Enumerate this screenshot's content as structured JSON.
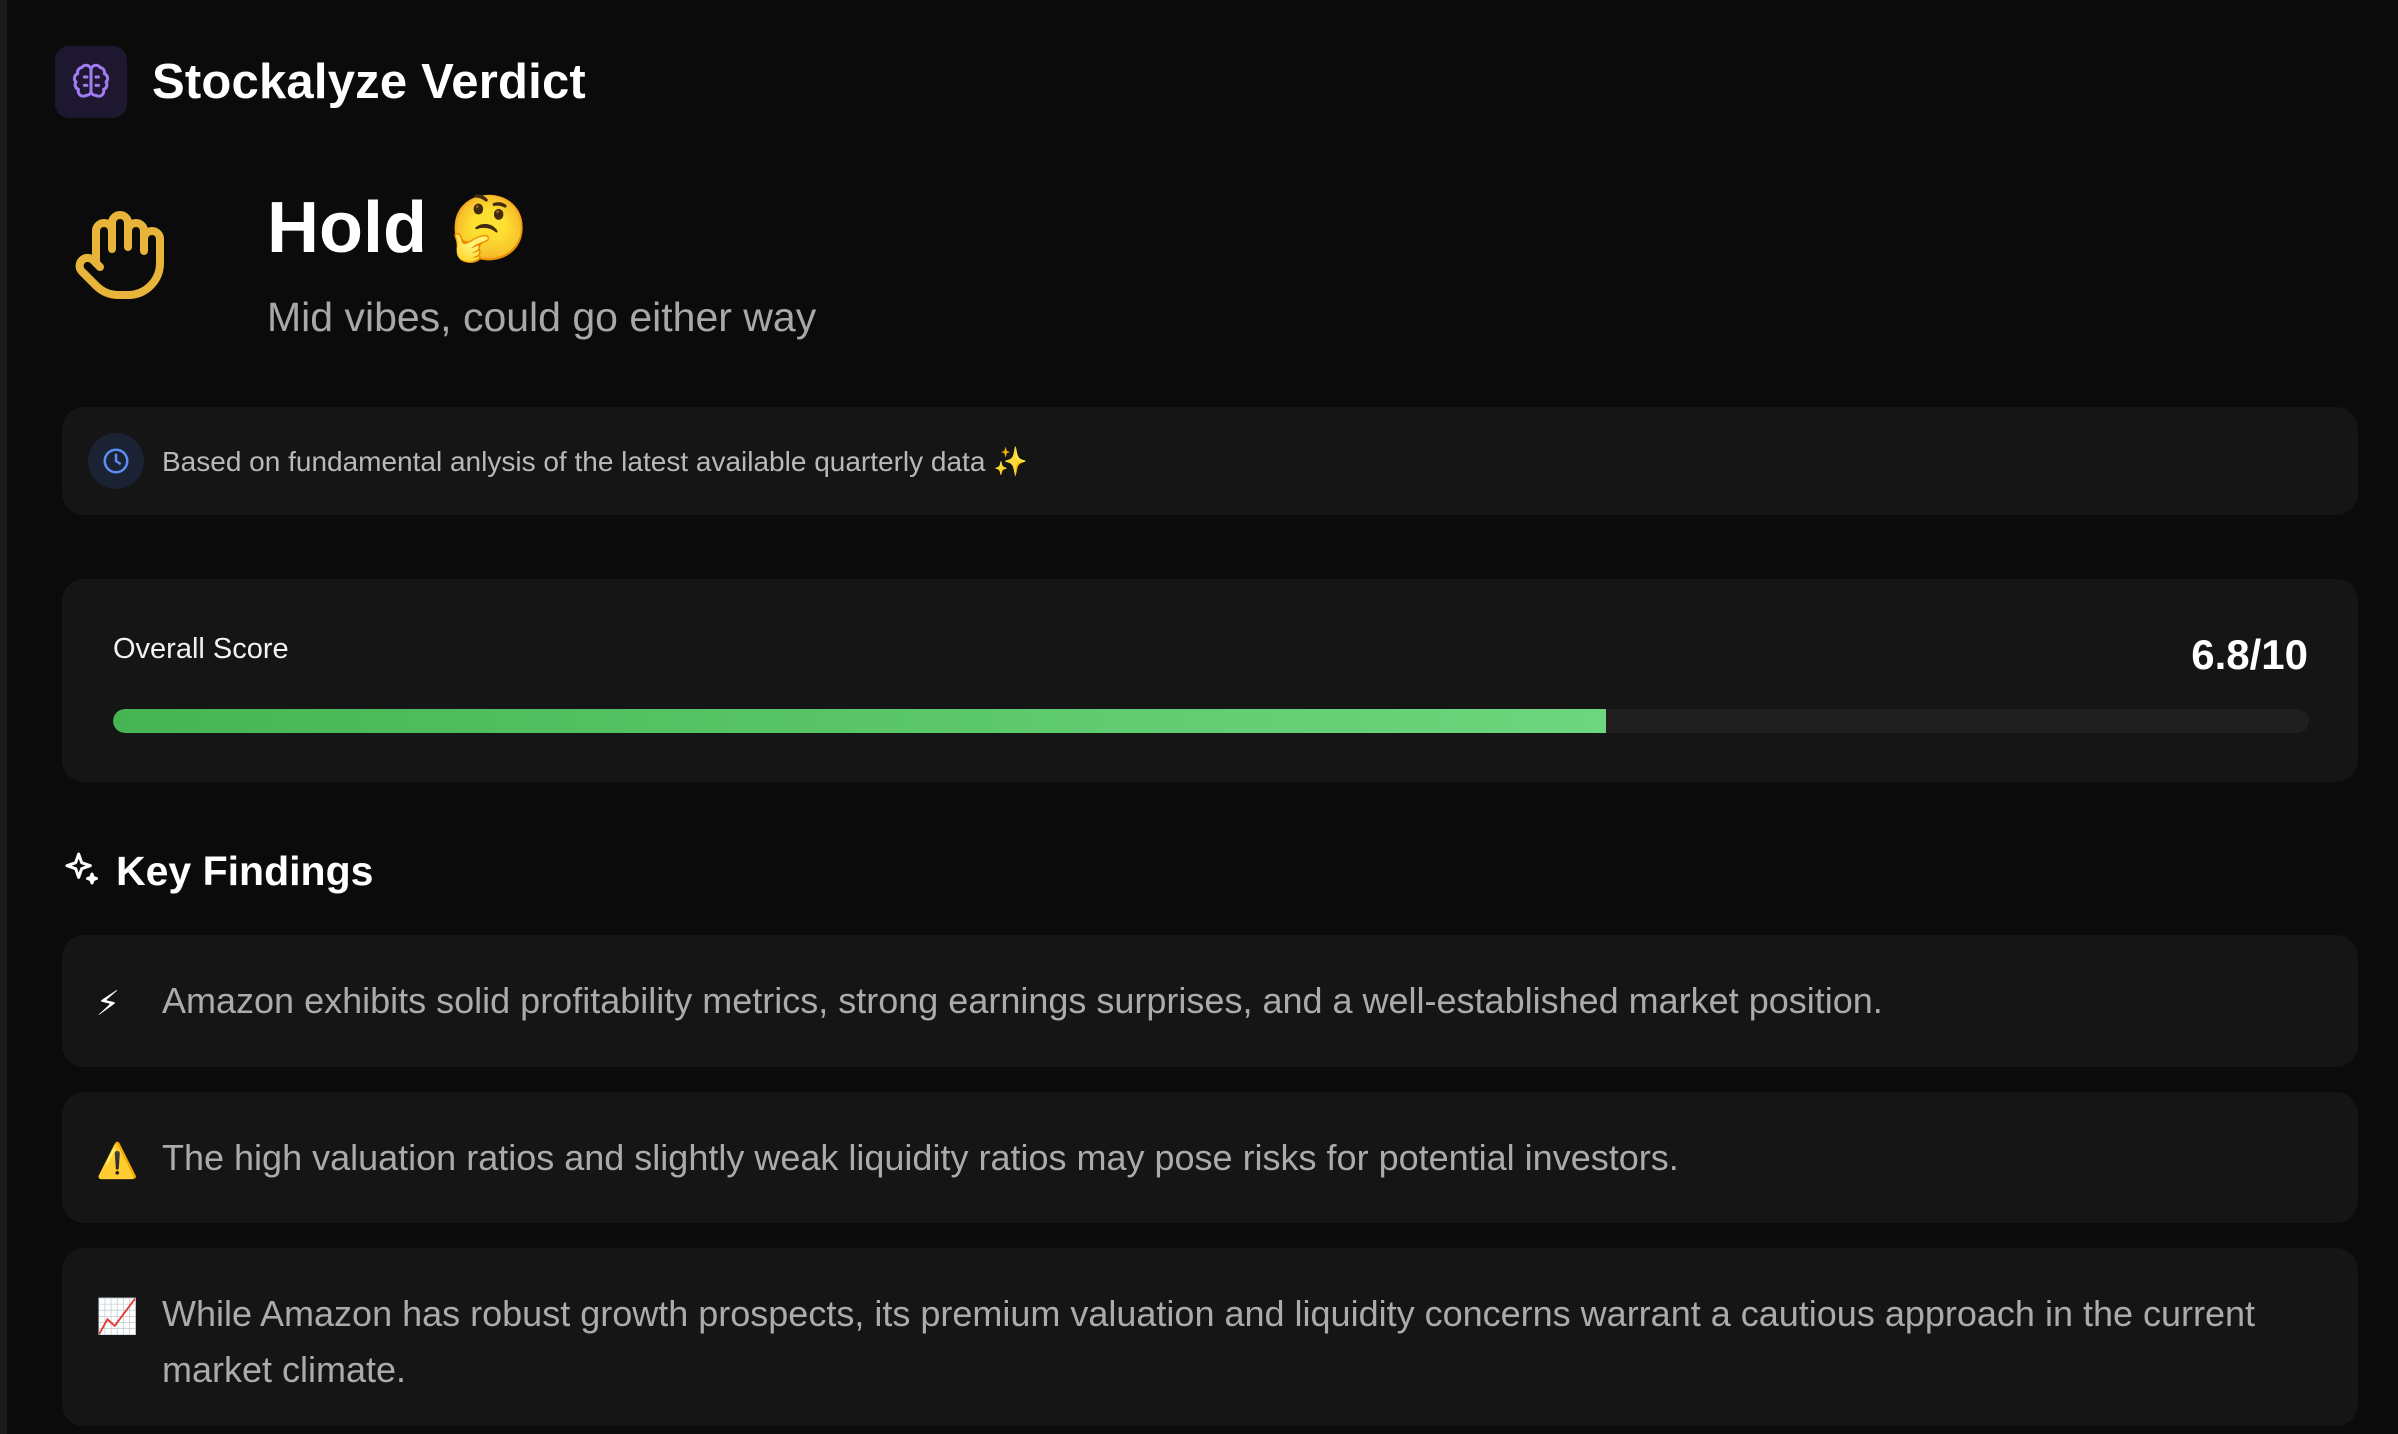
{
  "header": {
    "title": "Stockalyze Verdict",
    "icon": "brain-icon"
  },
  "verdict": {
    "icon": "hand-icon",
    "title": "Hold",
    "emoji": "🤔",
    "subtitle": "Mid vibes, could go either way"
  },
  "info": {
    "icon": "clock-icon",
    "text": "Based on fundamental anlysis of the latest available quarterly data ✨"
  },
  "score": {
    "label": "Overall Score",
    "value_text": "6.8/10",
    "value": 6.8,
    "max": 10
  },
  "findings": {
    "title": "Key Findings",
    "icon": "sparkle-icon",
    "items": [
      {
        "icon": "⚡",
        "icon_name": "lightning-icon",
        "text": "Amazon exhibits solid profitability metrics, strong earnings surprises, and a well-established market position."
      },
      {
        "icon": "⚠️",
        "icon_name": "warning-icon",
        "text": "The high valuation ratios and slightly weak liquidity ratios may pose risks for potential investors."
      },
      {
        "icon": "📈",
        "icon_name": "chart-up-icon",
        "text": "While Amazon has robust growth prospects, its premium valuation and liquidity concerns warrant a cautious approach in the current market climate."
      }
    ]
  },
  "colors": {
    "background": "#0b0b0b",
    "card": "#151515",
    "accent_purple": "#a07cf0",
    "accent_gold": "#e8b53a",
    "accent_blue": "#5b8ef0",
    "score_green": "#5bc96b"
  }
}
